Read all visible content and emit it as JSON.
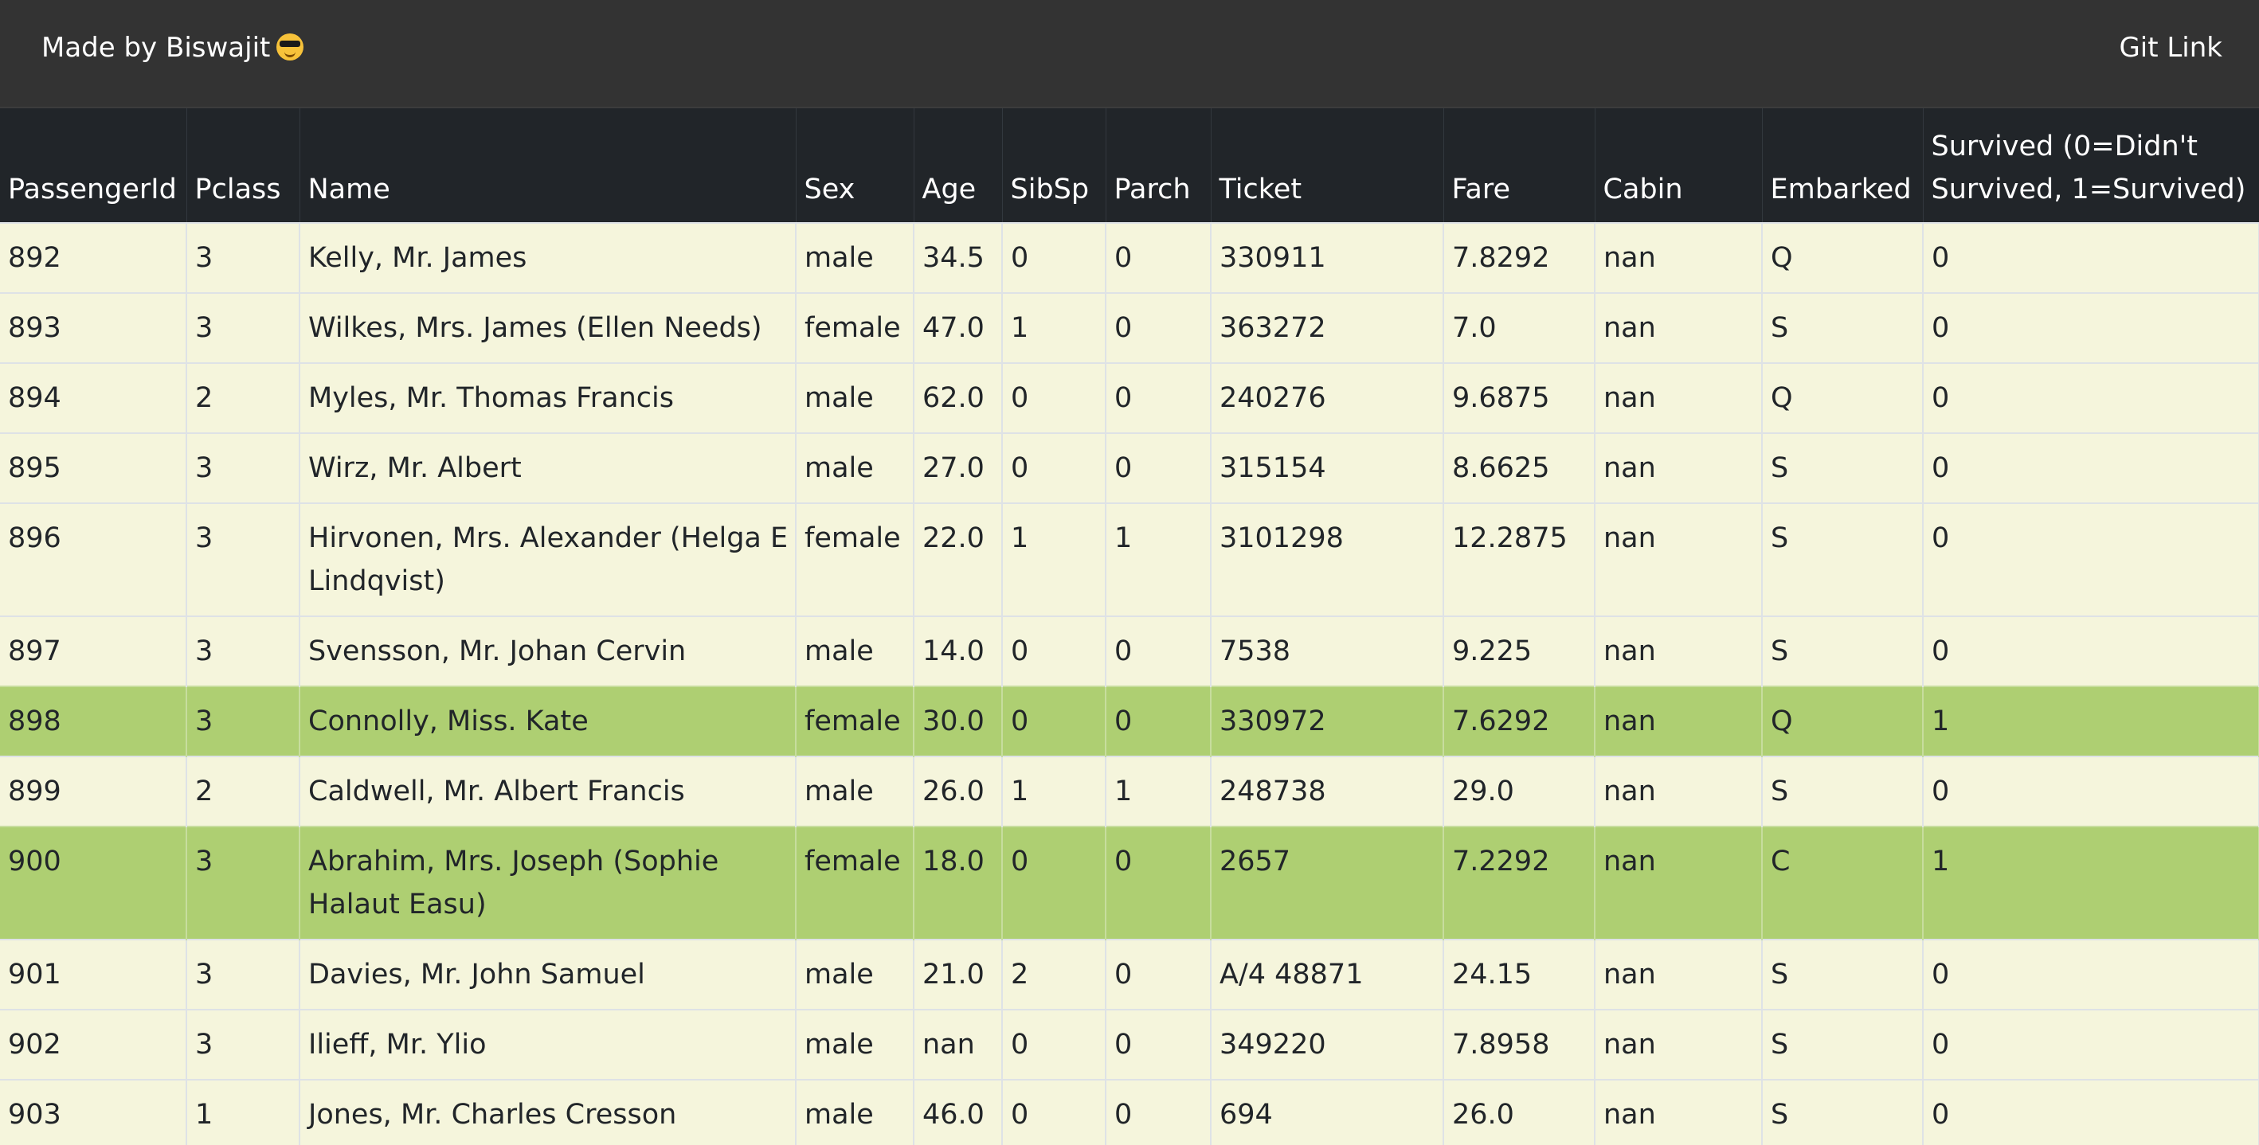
{
  "navbar": {
    "brand": "Made by Biswajit",
    "brand_emoji_icon": "smiling-face-with-sunglasses-icon",
    "git_link": "Git Link"
  },
  "colors": {
    "navbar_bg": "#333333",
    "header_bg": "#212529",
    "row_bg": "#f5f5dc",
    "survived_row_bg": "#aecf72"
  },
  "table": {
    "columns": [
      "PassengerId",
      "Pclass",
      "Name",
      "Sex",
      "Age",
      "SibSp",
      "Parch",
      "Ticket",
      "Fare",
      "Cabin",
      "Embarked",
      "Survived (0=Didn't Survived, 1=Survived)"
    ],
    "rows": [
      [
        "892",
        "3",
        "Kelly, Mr. James",
        "male",
        "34.5",
        "0",
        "0",
        "330911",
        "7.8292",
        "nan",
        "Q",
        "0"
      ],
      [
        "893",
        "3",
        "Wilkes, Mrs. James (Ellen Needs)",
        "female",
        "47.0",
        "1",
        "0",
        "363272",
        "7.0",
        "nan",
        "S",
        "0"
      ],
      [
        "894",
        "2",
        "Myles, Mr. Thomas Francis",
        "male",
        "62.0",
        "0",
        "0",
        "240276",
        "9.6875",
        "nan",
        "Q",
        "0"
      ],
      [
        "895",
        "3",
        "Wirz, Mr. Albert",
        "male",
        "27.0",
        "0",
        "0",
        "315154",
        "8.6625",
        "nan",
        "S",
        "0"
      ],
      [
        "896",
        "3",
        "Hirvonen, Mrs. Alexander (Helga E Lindqvist)",
        "female",
        "22.0",
        "1",
        "1",
        "3101298",
        "12.2875",
        "nan",
        "S",
        "0"
      ],
      [
        "897",
        "3",
        "Svensson, Mr. Johan Cervin",
        "male",
        "14.0",
        "0",
        "0",
        "7538",
        "9.225",
        "nan",
        "S",
        "0"
      ],
      [
        "898",
        "3",
        "Connolly, Miss. Kate",
        "female",
        "30.0",
        "0",
        "0",
        "330972",
        "7.6292",
        "nan",
        "Q",
        "1"
      ],
      [
        "899",
        "2",
        "Caldwell, Mr. Albert Francis",
        "male",
        "26.0",
        "1",
        "1",
        "248738",
        "29.0",
        "nan",
        "S",
        "0"
      ],
      [
        "900",
        "3",
        "Abrahim, Mrs. Joseph (Sophie Halaut Easu)",
        "female",
        "18.0",
        "0",
        "0",
        "2657",
        "7.2292",
        "nan",
        "C",
        "1"
      ],
      [
        "901",
        "3",
        "Davies, Mr. John Samuel",
        "male",
        "21.0",
        "2",
        "0",
        "A/4 48871",
        "24.15",
        "nan",
        "S",
        "0"
      ],
      [
        "902",
        "3",
        "Ilieff, Mr. Ylio",
        "male",
        "nan",
        "0",
        "0",
        "349220",
        "7.8958",
        "nan",
        "S",
        "0"
      ],
      [
        "903",
        "1",
        "Jones, Mr. Charles Cresson",
        "male",
        "46.0",
        "0",
        "0",
        "694",
        "26.0",
        "nan",
        "S",
        "0"
      ]
    ]
  }
}
